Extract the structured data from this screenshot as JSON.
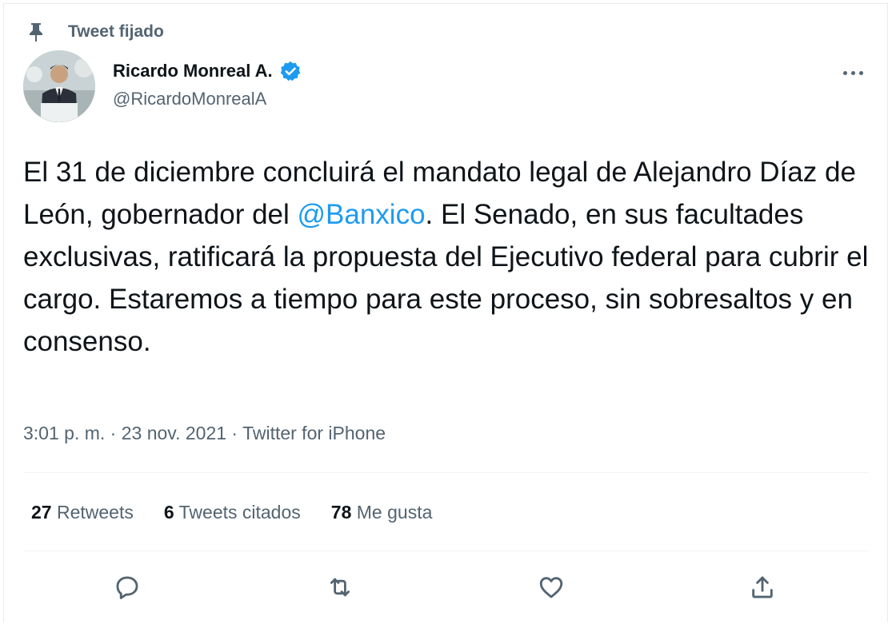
{
  "pinned": {
    "label": "Tweet fijado",
    "icon": "pin-icon"
  },
  "author": {
    "name": "Ricardo Monreal A.",
    "handle": "@RicardoMonrealA",
    "verified_icon": "verified-badge-icon",
    "avatar": "avatar-photo"
  },
  "tweet": {
    "text_part1": "El 31 de diciembre concluirá el mandato legal de Alejandro Díaz de León, gobernador del ",
    "mention": "@Banxico",
    "text_part2": ". El Senado, en sus facultades exclusivas, ratificará la propuesta del Ejecutivo federal para cubrir el cargo. Estaremos a tiempo para este proceso, sin sobresaltos y en consenso."
  },
  "meta": {
    "time": "3:01 p. m.",
    "separator1": " · ",
    "date": "23 nov. 2021",
    "separator2": " · ",
    "source": "Twitter for iPhone"
  },
  "stats": [
    {
      "count": "27",
      "label": "Retweets"
    },
    {
      "count": "6",
      "label": "Tweets citados"
    },
    {
      "count": "78",
      "label": "Me gusta"
    }
  ],
  "actions": [
    "reply-icon",
    "retweet-icon",
    "like-icon",
    "share-icon"
  ],
  "colors": {
    "accent": "#1d9bf0",
    "secondary_text": "#536471",
    "primary_text": "#0f1419"
  }
}
